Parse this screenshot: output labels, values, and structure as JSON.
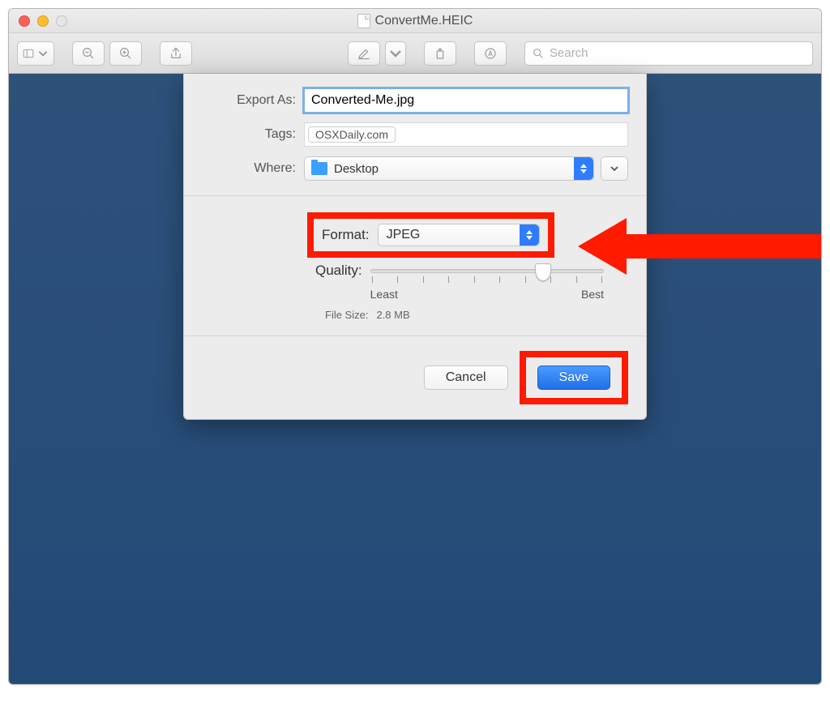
{
  "window": {
    "title": "ConvertMe.HEIC"
  },
  "toolbar": {
    "search_placeholder": "Search"
  },
  "sheet": {
    "export_as": {
      "label": "Export As:",
      "value": "Converted-Me.jpg"
    },
    "tags": {
      "label": "Tags:",
      "value": "OSXDaily.com"
    },
    "where": {
      "label": "Where:",
      "value": "Desktop"
    },
    "format": {
      "label": "Format:",
      "value": "JPEG"
    },
    "quality": {
      "label": "Quality:",
      "min_label": "Least",
      "max_label": "Best"
    },
    "filesize": {
      "label": "File Size:",
      "value": "2.8 MB"
    },
    "buttons": {
      "cancel": "Cancel",
      "save": "Save"
    }
  },
  "annotations": {
    "highlight_color": "#ff1a00"
  }
}
